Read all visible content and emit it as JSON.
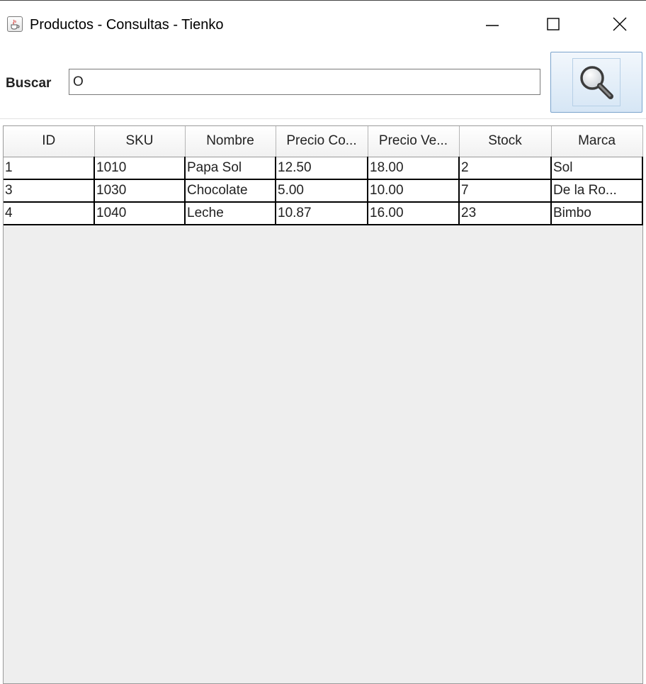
{
  "window": {
    "title": "Productos - Consultas - Tienko"
  },
  "icons": {
    "app": "java-coffee-icon",
    "minimize": "minimize-icon",
    "maximize": "maximize-icon",
    "close": "close-icon",
    "search": "magnifier-icon"
  },
  "search": {
    "label": "Buscar",
    "value": "O"
  },
  "table": {
    "columns": [
      "ID",
      "SKU",
      "Nombre",
      "Precio Co...",
      "Precio Ve...",
      "Stock",
      "Marca"
    ],
    "rows": [
      [
        "1",
        "1010",
        "Papa Sol",
        "12.50",
        "18.00",
        "2",
        "Sol"
      ],
      [
        "3",
        "1030",
        "Chocolate",
        "5.00",
        "10.00",
        "7",
        "De la Ro..."
      ],
      [
        "4",
        "1040",
        "Leche",
        "10.87",
        "16.00",
        "23",
        "Bimbo"
      ]
    ]
  },
  "colors": {
    "panel_bg": "#eeeeee",
    "button_border": "#7aa3cc",
    "grid_line": "#000000"
  }
}
